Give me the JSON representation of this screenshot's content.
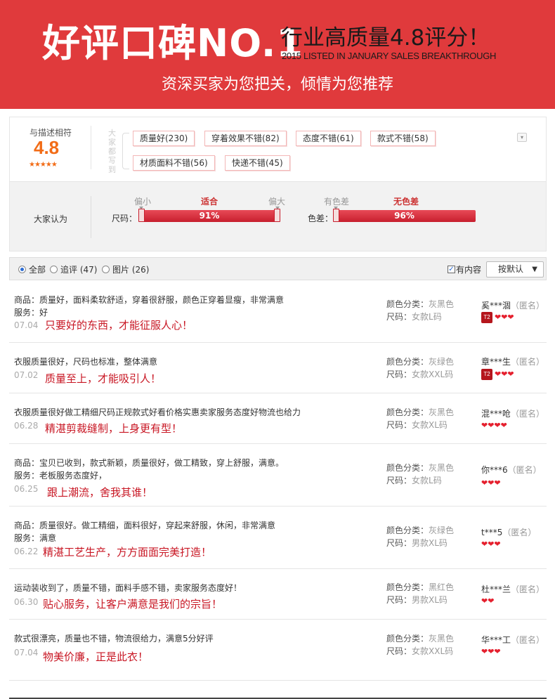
{
  "banner": {
    "title": "好评口碑NO.1",
    "subtitle": "行业高质量4.8评分！",
    "subtitle_en": "2015 LISTED IN JANUARY SALES BREAKTHROUGH",
    "slogan": "资深买家为您把关，倾情为您推荐"
  },
  "rating": {
    "label": "与描述相符",
    "score": "4.8",
    "stars": "★★★★★",
    "tag_caption": "大家都写到",
    "tags": [
      "质量好(230)",
      "穿着效果不错(82)",
      "态度不错(61)",
      "款式不错(58)",
      "材质面料不错(56)",
      "快递不错(45)"
    ],
    "toggle_icon": "chevron-down-icon"
  },
  "opinion": {
    "label": "大家认为",
    "size": {
      "name": "尺码：",
      "left": "偏小",
      "mid": "适合",
      "right": "偏大",
      "value_text": "91%",
      "value": 0.91
    },
    "color": {
      "name": "色差：",
      "left": "有色差",
      "mid": "无色差",
      "value_text": "96%",
      "value": 0.96
    }
  },
  "filter": {
    "options": [
      {
        "label": "全部",
        "checked": true
      },
      {
        "label": "追评 (47)",
        "checked": false
      },
      {
        "label": "图片 (26)",
        "checked": false
      }
    ],
    "has_content_label": "有内容",
    "has_content_checked": true,
    "sort_label": "按默认",
    "sort_arrow": "▼"
  },
  "reviews": [
    {
      "lines": [
        "商品：质量好，面料柔软舒适，穿着很舒服，颜色正穿着显瘦，非常满意",
        "服务：好"
      ],
      "date": "07.04",
      "quote": "只要好的东西，才能征服人心！",
      "color_label": "颜色分类：",
      "color": "灰黑色",
      "size_label": "尺码：",
      "size": "女款L码",
      "user": "奚***涸",
      "anon": "（匿名）",
      "level_badge": "T2",
      "hearts": "❤❤❤"
    },
    {
      "lines": [
        "衣服质量很好，尺码也标准，整体满意"
      ],
      "date": "07.02",
      "quote": "质量至上，才能吸引人！",
      "color_label": "颜色分类：",
      "color": "灰绿色",
      "size_label": "尺码：",
      "size": "女款XXL码",
      "user": "章***生",
      "anon": "（匿名）",
      "level_badge": "T2",
      "hearts": "❤❤❤"
    },
    {
      "lines": [
        "衣服质量很好做工精细尺码正规款式好看价格实惠卖家服务态度好物流也给力"
      ],
      "date": "06.28",
      "quote": "精湛剪裁缝制，上身更有型！",
      "color_label": "颜色分类：",
      "color": "灰黑色",
      "size_label": "尺码：",
      "size": "女款XL码",
      "user": "混***呛",
      "anon": "（匿名）",
      "level_badge": "",
      "hearts": "❤❤❤❤"
    },
    {
      "lines": [
        "商品：宝贝已收到，款式新颖，质量很好，做工精致，穿上舒服，满意。",
        "服务：老板服务态度好，"
      ],
      "date": "06.25",
      "quote": "跟上潮流，舍我其谁！",
      "color_label": "颜色分类：",
      "color": "灰黑色",
      "size_label": "尺码：",
      "size": "女款L码",
      "user": "你***6",
      "anon": "（匿名）",
      "level_badge": "",
      "hearts": "❤❤❤"
    },
    {
      "lines": [
        "商品：质量很好。做工精细，面料很好，穿起来舒服，休闲，非常满意",
        "服务：满意"
      ],
      "date": "06.22",
      "quote": "精湛工艺生产，方方面面完美打造！",
      "color_label": "颜色分类：",
      "color": "灰绿色",
      "size_label": "尺码：",
      "size": "男款XL码",
      "user": "t***5",
      "anon": "（匿名）",
      "level_badge": "",
      "hearts": "❤❤❤"
    },
    {
      "lines": [
        "运动装收到了，质量不错，面料手感不错，卖家服务态度好！"
      ],
      "date": "06.30",
      "quote": "贴心服务，让客户满意是我们的宗旨！",
      "color_label": "颜色分类：",
      "color": "黑红色",
      "size_label": "尺码：",
      "size": "男款XL码",
      "user": "杜***兰",
      "anon": "（匿名）",
      "level_badge": "",
      "hearts": "❤❤"
    },
    {
      "lines": [
        "款式很漂亮，质量也不错，物流很给力，满意5分好评"
      ],
      "date": "07.04",
      "quote": "物美价廉，正是此衣！",
      "color_label": "颜色分类：",
      "color": "灰黑色",
      "size_label": "尺码：",
      "size": "女款XXL码",
      "user": "华***工",
      "anon": "（匿名）",
      "level_badge": "",
      "hearts": "❤❤❤"
    }
  ],
  "colors": {
    "brand_red": "#e03a3c",
    "score_orange": "#f26c17",
    "quote_red": "#c81623"
  }
}
